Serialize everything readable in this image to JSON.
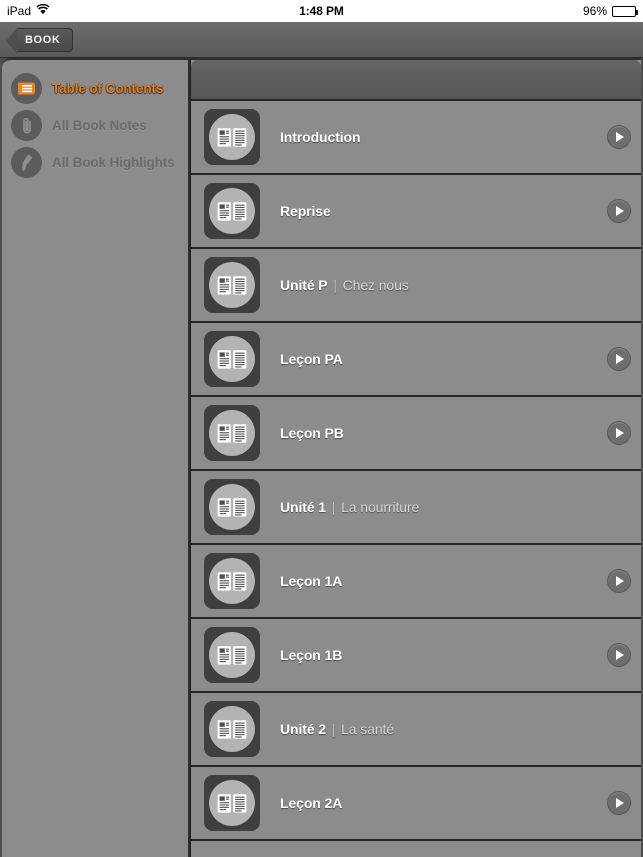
{
  "status_bar": {
    "device_label": "iPad",
    "wifi_icon": "wifi-icon",
    "time": "1:48 PM",
    "battery_percent": "96%",
    "battery_icon": "battery-icon"
  },
  "nav_bar": {
    "back_label": "BOOK",
    "back_icon": "back-chevron-icon"
  },
  "sidebar": {
    "items": [
      {
        "label": "Table of Contents",
        "icon": "book-icon",
        "active": true
      },
      {
        "label": "All Book Notes",
        "icon": "paperclip-icon",
        "active": false
      },
      {
        "label": "All Book Highlights",
        "icon": "highlighter-icon",
        "active": false
      }
    ]
  },
  "toc": {
    "row_icon": "open-book-icon",
    "play_icon": "play-icon",
    "rows": [
      {
        "title": "Introduction",
        "subtitle": "",
        "has_play": true
      },
      {
        "title": "Reprise",
        "subtitle": "",
        "has_play": true
      },
      {
        "title": "Unité P",
        "subtitle": "Chez nous",
        "has_play": false
      },
      {
        "title": "Leçon PA",
        "subtitle": "",
        "has_play": true
      },
      {
        "title": "Leçon PB",
        "subtitle": "",
        "has_play": true
      },
      {
        "title": "Unité 1",
        "subtitle": "La nourriture",
        "has_play": false
      },
      {
        "title": "Leçon 1A",
        "subtitle": "",
        "has_play": true
      },
      {
        "title": "Leçon 1B",
        "subtitle": "",
        "has_play": true
      },
      {
        "title": "Unité 2",
        "subtitle": "La santé",
        "has_play": false
      },
      {
        "title": "Leçon 2A",
        "subtitle": "",
        "has_play": true
      }
    ]
  },
  "colors": {
    "accent_orange": "#e07b1e",
    "panel_gray": "#8c8c8c",
    "chrome_dark": "#4d4d4d"
  }
}
